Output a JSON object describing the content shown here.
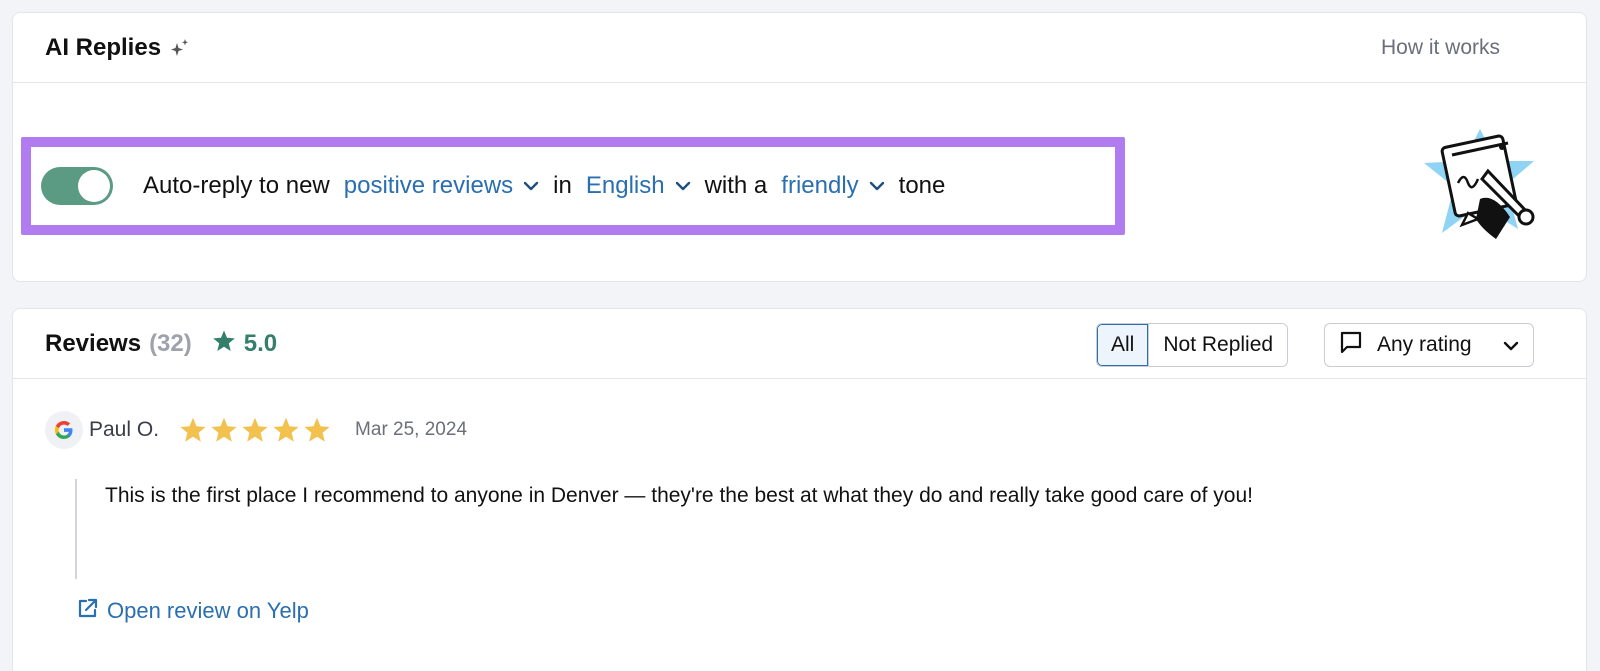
{
  "ai_card": {
    "title": "AI Replies",
    "how_link": "How it works",
    "sentence": {
      "prefix": "Auto-reply to new",
      "review_type": "positive reviews",
      "in_word": "in",
      "language": "English",
      "with_word": "with a",
      "tone": "friendly",
      "suffix": "tone"
    },
    "toggle_on": true
  },
  "reviews": {
    "title": "Reviews",
    "count": "(32)",
    "rating": "5.0",
    "filters": [
      "All",
      "Not Replied"
    ],
    "active_filter": "All",
    "rating_select": "Any rating",
    "items": [
      {
        "author": "Paul O.",
        "stars": 5,
        "date": "Mar 25, 2024",
        "text": "This is the first place I recommend to anyone in Denver — they're the best at what they do and really take good care of you!",
        "link": "Open review on Yelp"
      }
    ]
  },
  "colors": {
    "accent": "#2a6fb0",
    "toggle": "#5b9a83",
    "highlight": "#b07cf0",
    "star": "#f2c14e",
    "rating_green": "#347f6a"
  }
}
